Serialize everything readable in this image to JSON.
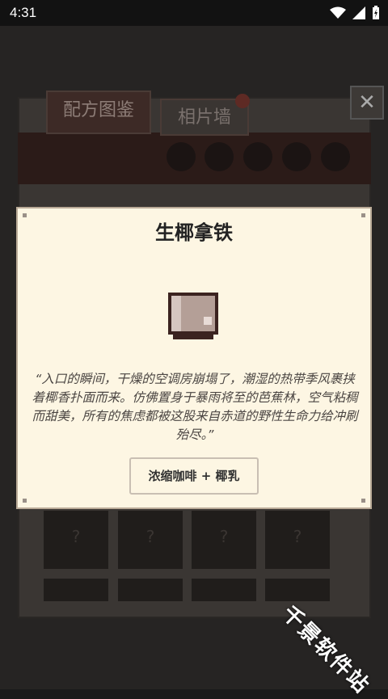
{
  "status_bar": {
    "time": "4:31"
  },
  "tabs": {
    "recipes": "配方图鉴",
    "photos": "相片墙"
  },
  "close_label": "✕",
  "grid_placeholder": "?",
  "dialog": {
    "title": "生椰拿铁",
    "quote": "“入口的瞬间，干燥的空调房崩塌了，潮湿的热带季风裹挟着椰香扑面而来。仿佛置身于暴雨将至的芭蕉林，空气粘稠而甜美，所有的焦虑都被这股来自赤道的野性生命力给冲刷殆尽。”",
    "recipe": "浓缩咖啡 + 椰乳"
  },
  "watermark": "千景软件站",
  "colors": {
    "dialog_bg": "#fdf6e3",
    "accent_dark": "#3d2a26"
  }
}
